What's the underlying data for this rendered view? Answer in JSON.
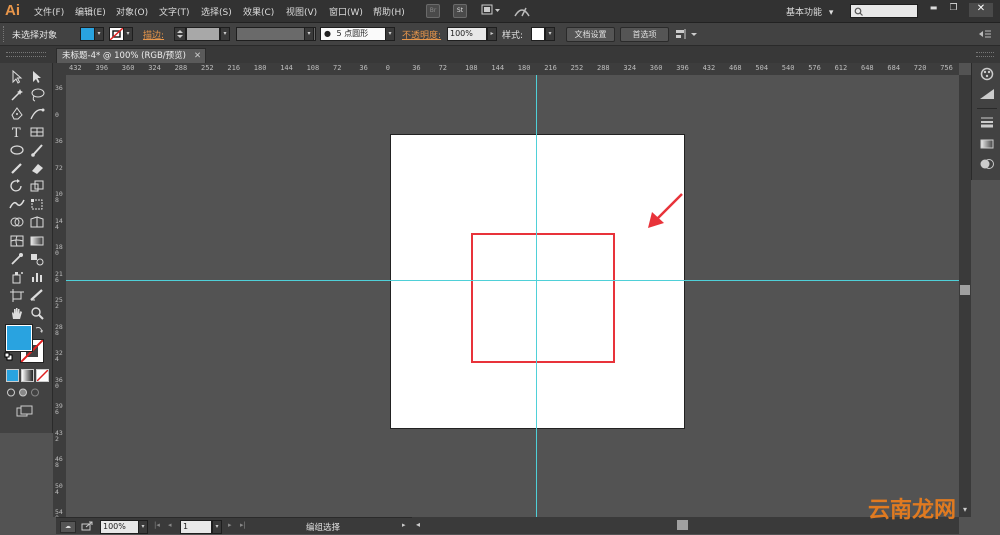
{
  "app": {
    "logo": "Ai"
  },
  "menu": [
    "文件(F)",
    "编辑(E)",
    "对象(O)",
    "文字(T)",
    "选择(S)",
    "效果(C)",
    "视图(V)",
    "窗口(W)",
    "帮助(H)"
  ],
  "menubar_badges": {
    "br": "Br",
    "st": "St"
  },
  "workspace": {
    "label": "基本功能",
    "arrow": "▾"
  },
  "search": {
    "placeholder": ""
  },
  "window_controls": {
    "minimize": "▬",
    "restore": "❐",
    "close": "✕"
  },
  "control": {
    "selection_label": "未选择对象",
    "stroke_label": "描边:",
    "brush_label": "5 点圆形",
    "opacity_label": "不透明度:",
    "opacity_value": "100%",
    "style_label": "样式:",
    "doc_setup": "文档设置",
    "prefs": "首选项",
    "fill_color": "#29a3e0"
  },
  "document": {
    "tab_title": "未标题-4* @ 100% (RGB/预览)",
    "close": "✕"
  },
  "ruler": {
    "h_labels": [
      "432",
      "396",
      "360",
      "324",
      "288",
      "252",
      "216",
      "180",
      "144",
      "108",
      "72",
      "36",
      "0",
      "36",
      "72",
      "108",
      "144",
      "180",
      "216",
      "252",
      "288",
      "324",
      "360",
      "396",
      "432",
      "468",
      "504",
      "540",
      "576",
      "612",
      "648",
      "684",
      "720",
      "756"
    ],
    "v_labels": [
      "36",
      "0",
      "36",
      "72",
      "108",
      "144",
      "180",
      "216",
      "252",
      "288",
      "324",
      "360",
      "396",
      "432",
      "468",
      "504",
      "540"
    ]
  },
  "guides": {
    "color": "#4fd0d8"
  },
  "shape": {
    "stroke": "#e8333a"
  },
  "arrow": {
    "color": "#e8333a"
  },
  "status": {
    "zoom": "100%",
    "page": "1",
    "mode": "编组选择"
  },
  "watermark": "云南龙网"
}
